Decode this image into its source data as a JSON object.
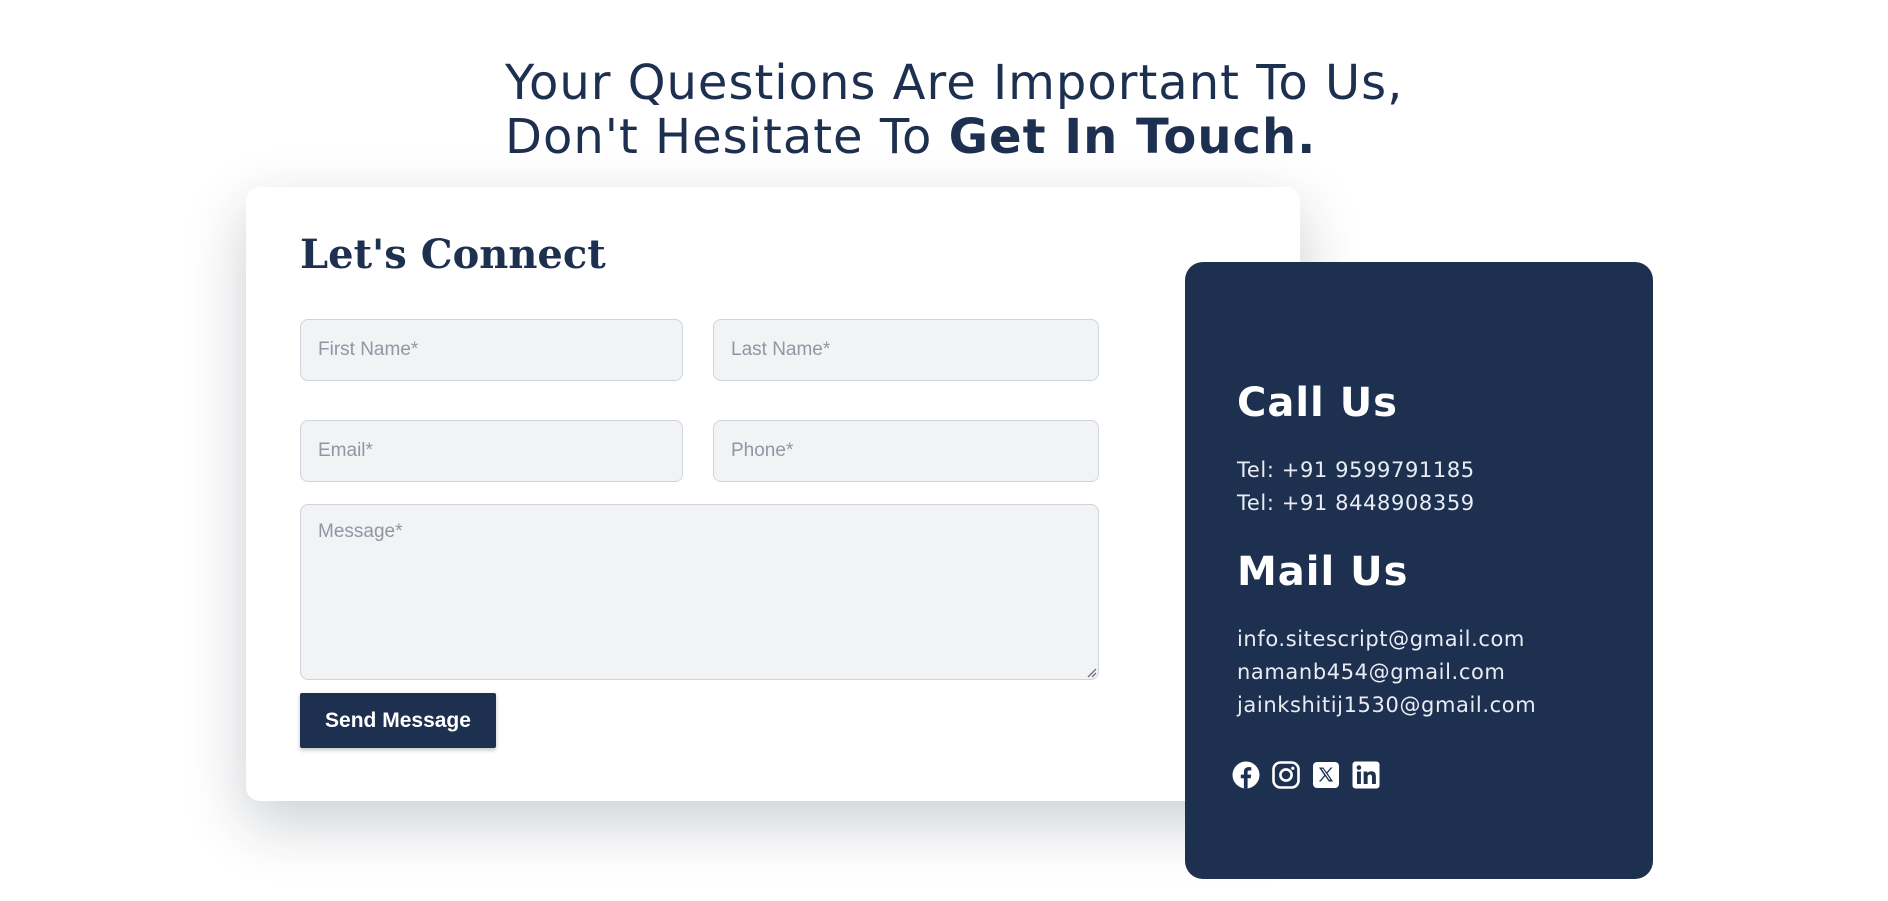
{
  "header": {
    "line1": "Your Questions Are Important To Us,",
    "line2_prefix": "Don't Hesitate To ",
    "line2_emphasis": "Get In Touch."
  },
  "form": {
    "title": "Let's Connect",
    "first_name": {
      "placeholder": "First Name*",
      "value": ""
    },
    "last_name": {
      "placeholder": "Last Name*",
      "value": ""
    },
    "email": {
      "placeholder": "Email*",
      "value": ""
    },
    "phone": {
      "placeholder": "Phone*",
      "value": ""
    },
    "message": {
      "placeholder": "Message*",
      "value": ""
    },
    "submit_label": "Send Message"
  },
  "contact": {
    "call_heading": "Call Us",
    "phones": [
      "Tel: +91 9599791185",
      "Tel: +91 8448908359"
    ],
    "mail_heading": "Mail Us",
    "emails": [
      "info.sitescript@gmail.com",
      "namanb454@gmail.com",
      "jainkshitij1530@gmail.com"
    ],
    "social": [
      "facebook-icon",
      "instagram-icon",
      "x-twitter-icon",
      "linkedin-icon"
    ]
  },
  "colors": {
    "navy": "#1e3050",
    "field_bg": "#f2f3f5",
    "field_border": "#cfd4dc",
    "placeholder": "#8f97a3"
  }
}
